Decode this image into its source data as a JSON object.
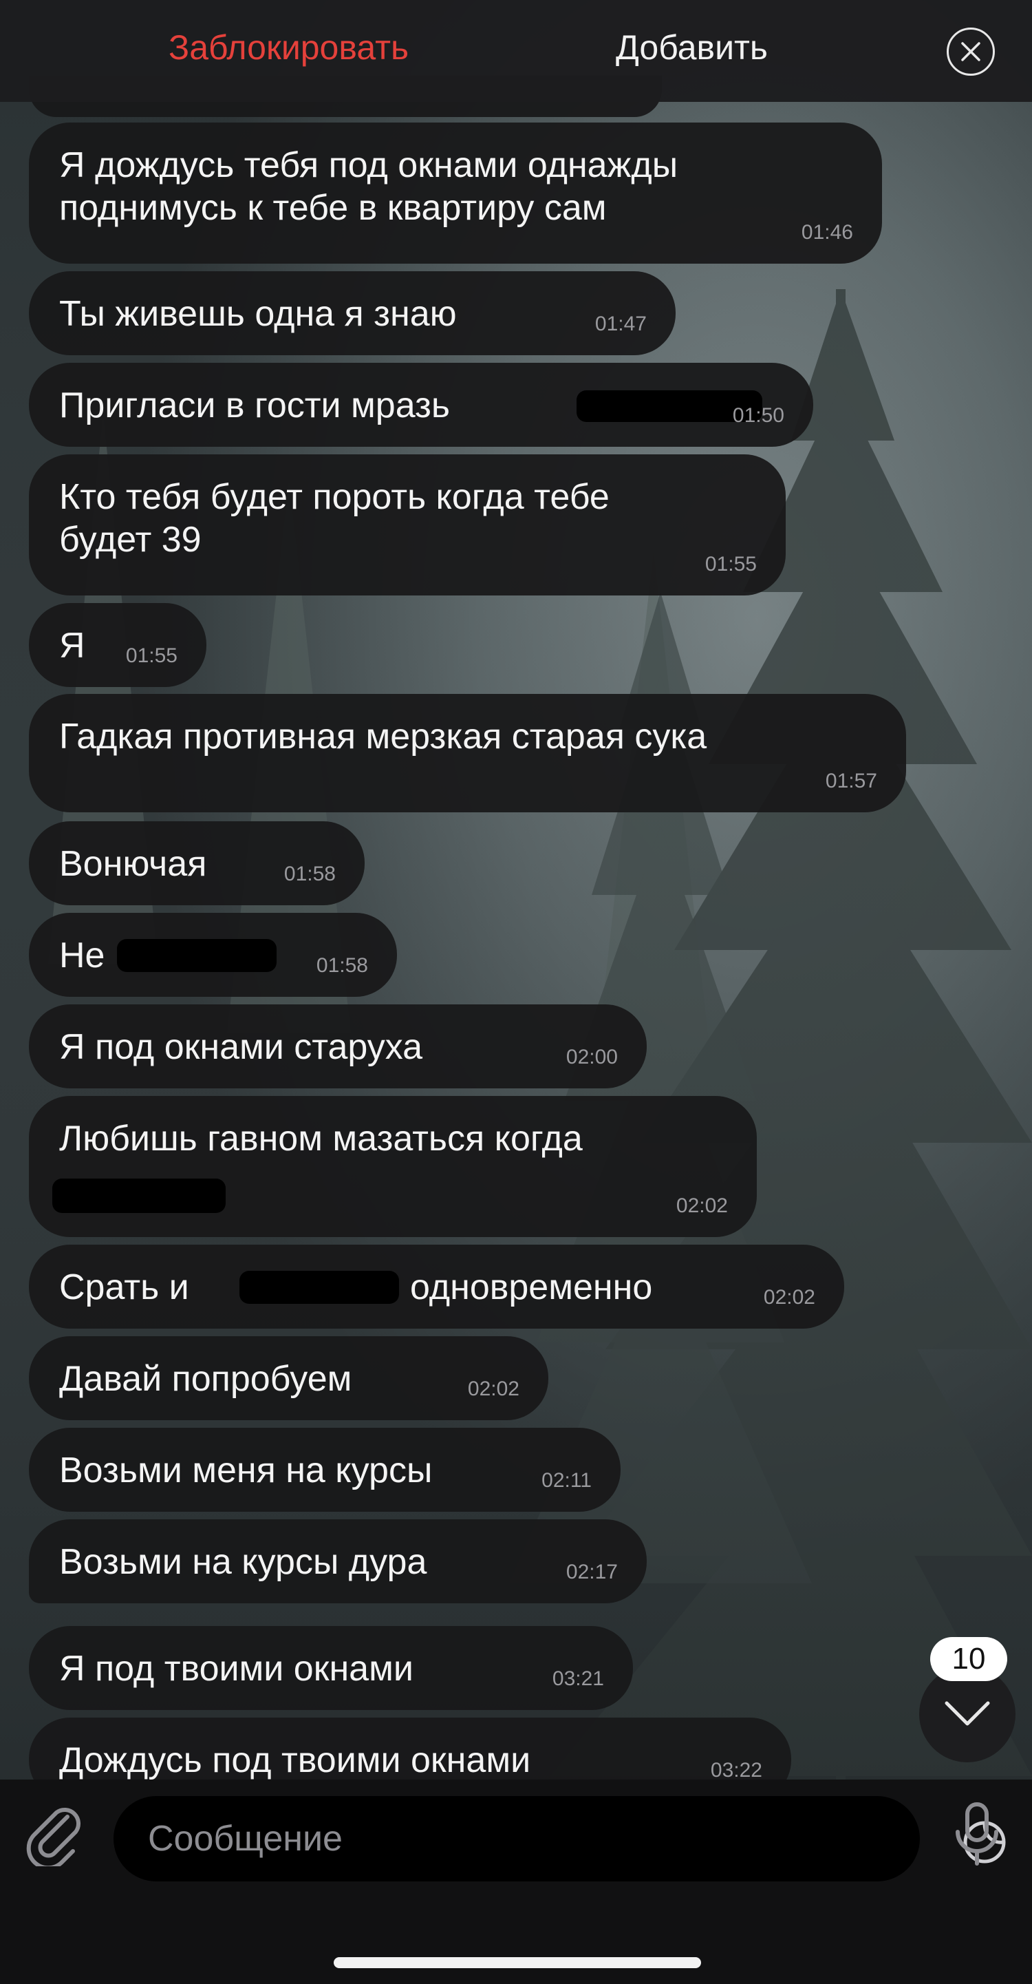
{
  "header": {
    "block_label": "Заблокировать",
    "add_label": "Добавить",
    "close_icon": "close-circle-icon"
  },
  "messages": [
    {
      "text": "Я дождусь тебя под окнами однажды\nподнимусь к тебе в квартиру сам",
      "time": "01:46"
    },
    {
      "text": "Ты живешь одна я знаю",
      "time": "01:47"
    },
    {
      "text": "Пригласи в гости мразь",
      "time": "01:50"
    },
    {
      "text": "Кто тебя будет пороть когда тебе\nбудет 39",
      "time": "01:55"
    },
    {
      "text": "Я",
      "time": "01:55"
    },
    {
      "text": "Гадкая противная мерзкая старая сука",
      "time": "01:57"
    },
    {
      "text": "Вонючая",
      "time": "01:58"
    },
    {
      "text": "Не",
      "time": "01:58"
    },
    {
      "text": "Я под окнами старуха",
      "time": "02:00"
    },
    {
      "text": "Любишь гавном мазаться когда",
      "time": "02:02"
    },
    {
      "text": "Срать и",
      "text_after": "одновременно",
      "time": "02:02"
    },
    {
      "text": "Давай попробуем",
      "time": "02:02"
    },
    {
      "text": "Возьми меня на курсы",
      "time": "02:11"
    },
    {
      "text": "Возьми на курсы дура",
      "time": "02:17"
    },
    {
      "text": "Я под твоими окнами",
      "time": "03:21"
    },
    {
      "text": "Дождусь под твоими окнами",
      "time": "03:22"
    }
  ],
  "scroll": {
    "unread_badge": "10",
    "icon": "chevron-down-icon"
  },
  "composer": {
    "placeholder": "Сообщение",
    "attach_icon": "paperclip-icon",
    "sticker_icon": "sticker-icon",
    "mic_icon": "microphone-icon"
  },
  "colors": {
    "block_red": "#e5413b",
    "bubble_bg": "#18181a",
    "time_gray": "#9a9a9e"
  }
}
